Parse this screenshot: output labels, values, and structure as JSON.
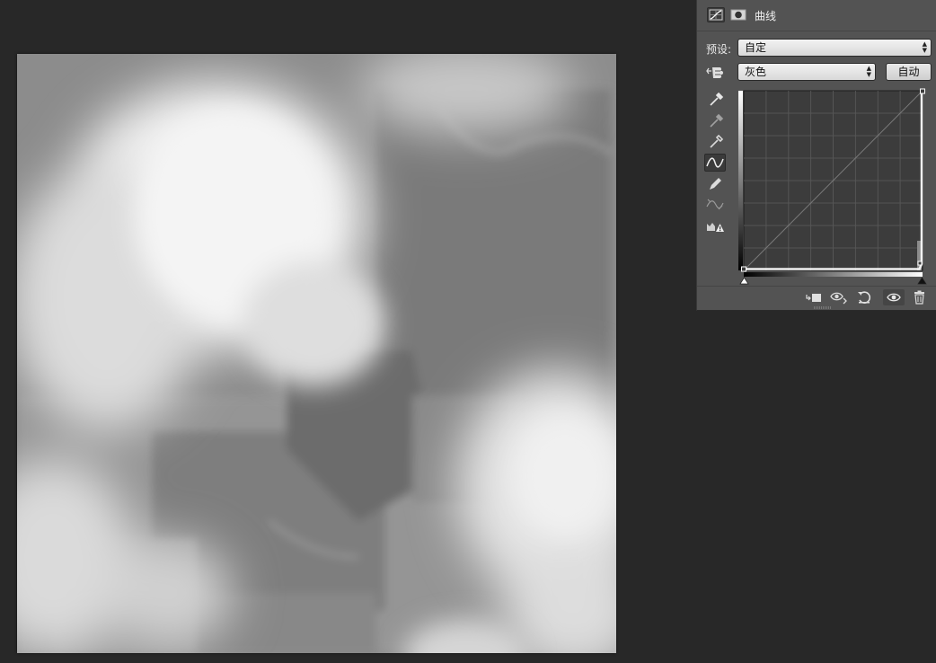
{
  "panel": {
    "title": "曲线",
    "preset_label": "预设:",
    "preset_value": "自定",
    "channel_value": "灰色",
    "auto_button": "自动"
  },
  "icons": {
    "header": [
      "curves-adjustment-icon",
      "layer-mask-icon"
    ],
    "tools": [
      "sample-white-point-eyedropper-icon",
      "sample-gray-point-eyedropper-icon",
      "sample-black-point-eyedropper-icon",
      "edit-curve-points-icon",
      "draw-curve-pencil-icon",
      "smooth-curve-icon",
      "clipping-warning-icon"
    ],
    "footer": [
      "clip-to-layer-icon",
      "view-previous-state-icon",
      "reset-adjustment-icon",
      "toggle-visibility-icon",
      "delete-adjustment-icon"
    ]
  },
  "colors": {
    "workspace": "#282828",
    "panel": "#535353",
    "graph_bg": "#3c3c3c"
  }
}
